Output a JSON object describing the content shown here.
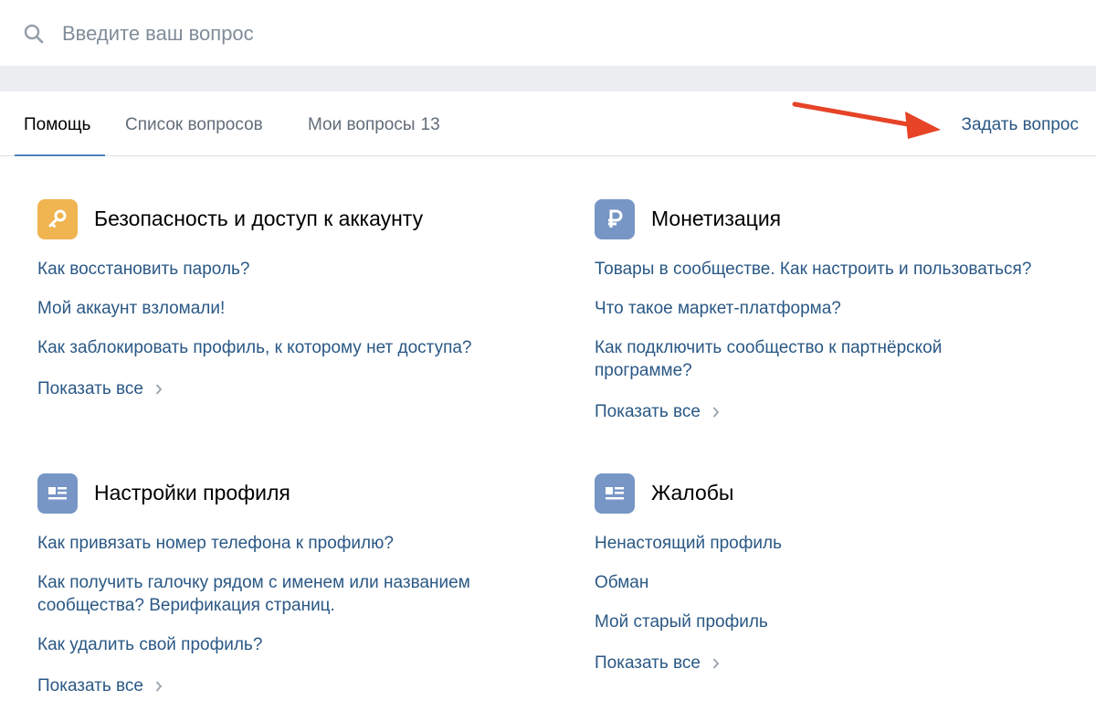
{
  "search": {
    "placeholder": "Введите ваш вопрос",
    "value": ""
  },
  "tabs": [
    {
      "label": "Помощь",
      "active": true
    },
    {
      "label": "Список вопросов",
      "active": false
    },
    {
      "label": "Мои вопросы",
      "count": "13",
      "active": false
    }
  ],
  "ask_button": "Задать вопрос",
  "colors": {
    "link": "#2a5885",
    "accent": "#5181b8",
    "key_icon_bg": "#f0b450",
    "section_icon_bg": "#7796c6",
    "arrow": "#e64327"
  },
  "sections": [
    {
      "icon": "key-icon",
      "title": "Безопасность и доступ к аккаунту",
      "questions": [
        "Как восстановить пароль?",
        "Мой аккаунт взломали!",
        "Как заблокировать профиль, к которому нет доступа?"
      ],
      "show_all": "Показать все"
    },
    {
      "icon": "ruble-icon",
      "title": "Монетизация",
      "questions": [
        "Товары в сообществе. Как настроить и пользоваться?",
        "Что такое маркет-платформа?",
        "Как подключить сообщество к партнёрской программе?"
      ],
      "show_all": "Показать все"
    },
    {
      "icon": "profile-card-icon",
      "title": "Настройки профиля",
      "questions": [
        "Как привязать номер телефона к профилю?",
        "Как получить галочку рядом с именем или названием сообщества? Верификация страниц.",
        "Как удалить свой профиль?"
      ],
      "show_all": "Показать все"
    },
    {
      "icon": "profile-card-icon",
      "title": "Жалобы",
      "questions": [
        "Ненастоящий профиль",
        "Обман",
        "Мой старый профиль"
      ],
      "show_all": "Показать все"
    }
  ]
}
